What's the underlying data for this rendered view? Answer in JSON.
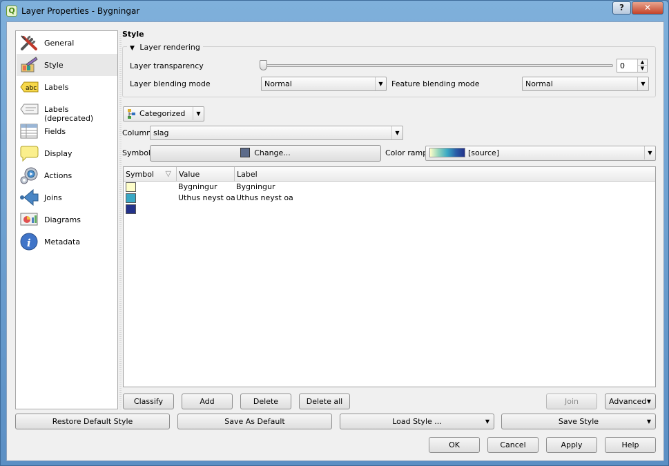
{
  "window": {
    "title": "Layer Properties - Bygningar",
    "help_btn": "?",
    "close_btn": "✕"
  },
  "sidebar": {
    "items": [
      {
        "label": "General",
        "icon": "tools-icon"
      },
      {
        "label": "Style",
        "icon": "style-icon"
      },
      {
        "label": "Labels",
        "icon": "labels-abc-icon"
      },
      {
        "label": "Labels (deprecated)",
        "icon": "labels-deprecated-icon"
      },
      {
        "label": "Fields",
        "icon": "fields-table-icon"
      },
      {
        "label": "Display",
        "icon": "display-bubble-icon"
      },
      {
        "label": "Actions",
        "icon": "actions-gear-icon"
      },
      {
        "label": "Joins",
        "icon": "joins-arrow-icon"
      },
      {
        "label": "Diagrams",
        "icon": "diagrams-icon"
      },
      {
        "label": "Metadata",
        "icon": "metadata-info-icon"
      }
    ],
    "active_index": 1
  },
  "style": {
    "title": "Style",
    "layer_rendering": {
      "label": "Layer rendering",
      "transparency_label": "Layer transparency",
      "transparency_value": "0",
      "blending_label": "Layer blending mode",
      "blending_value": "Normal",
      "feature_blending_label": "Feature blending mode",
      "feature_blending_value": "Normal"
    },
    "renderer": "Categorized",
    "column_label": "Column",
    "column_value": "slag",
    "symbol_label": "Symbol",
    "change_button": "Change...",
    "symbol_color": "#5c6b8a",
    "color_ramp_label": "Color ramp",
    "color_ramp_value": "[source]",
    "table": {
      "headers": [
        "Symbol",
        "Value",
        "Label"
      ],
      "rows": [
        {
          "color": "#fdfdc9",
          "value": "Bygningur",
          "label": "Bygningur"
        },
        {
          "color": "#3aa8c4",
          "value": "Uthus neyst oa",
          "label": "Uthus neyst oa"
        },
        {
          "color": "#23328a",
          "value": "",
          "label": ""
        }
      ]
    },
    "buttons": {
      "classify": "Classify",
      "add": "Add",
      "delete": "Delete",
      "delete_all": "Delete all",
      "join": "Join",
      "advanced": "Advanced"
    }
  },
  "footer": {
    "restore_default": "Restore Default Style",
    "save_as_default": "Save As Default",
    "load_style": "Load Style ...",
    "save_style": "Save Style",
    "ok": "OK",
    "cancel": "Cancel",
    "apply": "Apply",
    "help": "Help"
  }
}
